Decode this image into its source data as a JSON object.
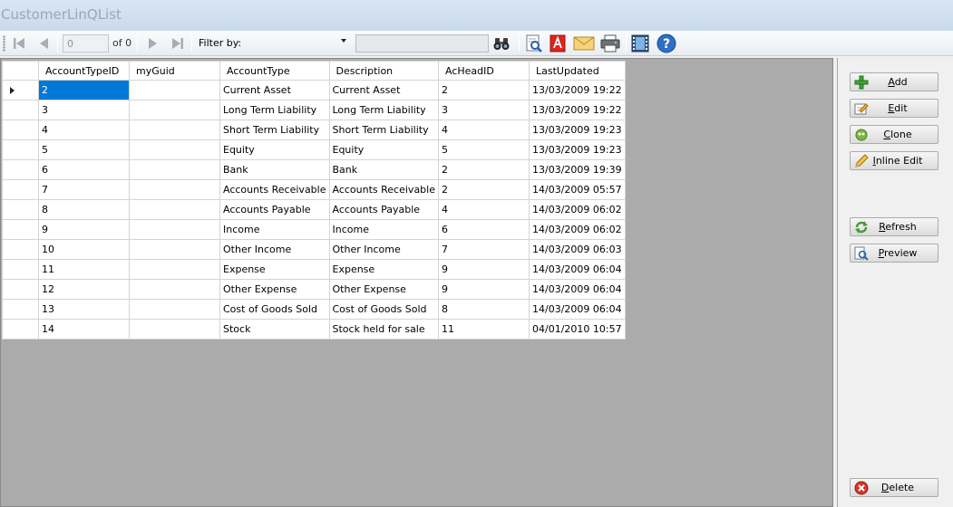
{
  "window": {
    "title": "CustomerLinQList"
  },
  "toolbar": {
    "position_value": "0",
    "of_label": "of 0",
    "filter_label": "Filter by:",
    "filter_select_value": "",
    "filter_text": ""
  },
  "grid": {
    "columns": [
      "AccountTypeID",
      "myGuid",
      "AccountType",
      "Description",
      "AcHeadID",
      "LastUpdated"
    ],
    "rows": [
      [
        "2",
        "",
        "Current Asset",
        "Current Asset",
        "2",
        "13/03/2009 19:22"
      ],
      [
        "3",
        "",
        "Long Term Liability",
        "Long Term Liability",
        "3",
        "13/03/2009 19:22"
      ],
      [
        "4",
        "",
        "Short Term Liability",
        "Short Term Liability",
        "4",
        "13/03/2009 19:23"
      ],
      [
        "5",
        "",
        "Equity",
        "Equity",
        "5",
        "13/03/2009 19:23"
      ],
      [
        "6",
        "",
        "Bank",
        "Bank",
        "2",
        "13/03/2009 19:39"
      ],
      [
        "7",
        "",
        "Accounts Receivable",
        "Accounts Receivable",
        "2",
        "14/03/2009 05:57"
      ],
      [
        "8",
        "",
        "Accounts Payable",
        "Accounts Payable",
        "4",
        "14/03/2009 06:02"
      ],
      [
        "9",
        "",
        "Income",
        "Income",
        "6",
        "14/03/2009 06:02"
      ],
      [
        "10",
        "",
        "Other Income",
        "Other Income",
        "7",
        "14/03/2009 06:03"
      ],
      [
        "11",
        "",
        "Expense",
        "Expense",
        "9",
        "14/03/2009 06:04"
      ],
      [
        "12",
        "",
        "Other Expense",
        "Other Expense",
        "9",
        "14/03/2009 06:04"
      ],
      [
        "13",
        "",
        "Cost of Goods Sold",
        "Cost of Goods Sold",
        "8",
        "14/03/2009 06:04"
      ],
      [
        "14",
        "",
        "Stock",
        "Stock held for sale",
        "11",
        "04/01/2010 10:57"
      ]
    ]
  },
  "buttons": {
    "add": {
      "mnemonic": "A",
      "rest": "dd"
    },
    "edit": {
      "mnemonic": "E",
      "rest": "dit"
    },
    "clone": {
      "mnemonic": "C",
      "rest": "lone"
    },
    "inline_edit": {
      "mnemonic": "I",
      "rest": "nline Edit"
    },
    "refresh": {
      "mnemonic": "R",
      "rest": "efresh"
    },
    "preview": {
      "mnemonic": "P",
      "rest": "review"
    },
    "delete": {
      "mnemonic": "D",
      "rest": "elete"
    }
  },
  "colors": {
    "selection": "#0078d7",
    "grid_background": "#ababab",
    "titlebar": "#c9d9ee"
  },
  "icons": [
    "move-first-icon",
    "move-previous-icon",
    "move-next-icon",
    "move-last-icon",
    "binoculars-icon",
    "search-document-icon",
    "pdf-icon",
    "email-icon",
    "printer-icon",
    "film-icon",
    "help-icon",
    "add-icon",
    "edit-icon",
    "clone-icon",
    "pencil-icon",
    "refresh-icon",
    "preview-icon",
    "delete-icon"
  ]
}
